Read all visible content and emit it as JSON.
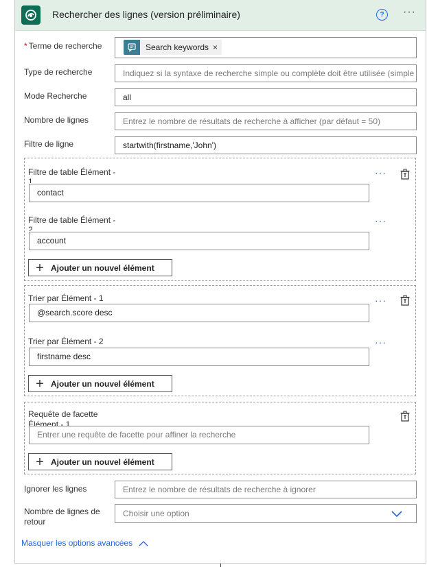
{
  "header": {
    "title": "Rechercher des lignes (version préliminaire)",
    "help": "?",
    "more": "···"
  },
  "fields": {
    "search_term_label": "Terme de recherche",
    "search_term_required": "*",
    "search_term_token": "Search keywords",
    "search_term_token_remove": "×",
    "search_type_label": "Type de recherche",
    "search_type_placeholder": "Indiquez si la syntaxe de recherche simple ou complète doit être utilisée (simple",
    "search_mode_label": "Mode Recherche",
    "search_mode_value": "all",
    "row_count_label": "Nombre de lignes",
    "row_count_placeholder": "Entrez le nombre de résultats de recherche à afficher (par défaut = 50)",
    "row_filter_label": "Filtre de ligne",
    "row_filter_value": "startwith(firstname,'John')",
    "skip_rows_label": "Ignorer les lignes",
    "skip_rows_placeholder": "Entrez le nombre de résultats de recherche à ignorer",
    "return_rows_label_line1": "Nombre de lignes de",
    "return_rows_label_line2": "retour",
    "return_rows_placeholder": "Choisir une option"
  },
  "table_filter": {
    "items": [
      {
        "label_line1": "Filtre de table Élément -",
        "label_line2": "1",
        "value": "contact"
      },
      {
        "label_line1": "Filtre de table Élément -",
        "label_line2": "2",
        "value": "account"
      }
    ],
    "add_label": "Ajouter un nouvel élément"
  },
  "order_by": {
    "items": [
      {
        "label": "Trier par Élément - 1",
        "value": "@search.score desc"
      },
      {
        "label": "Trier par Élément - 2",
        "value": "firstname desc"
      }
    ],
    "add_label": "Ajouter un nouvel élément"
  },
  "facet": {
    "label_line1": "Requête de facette",
    "label_line2": "Élément - 1",
    "placeholder": "Entrer une requête de facette pour affiner la recherche",
    "add_label": "Ajouter un nouvel élément"
  },
  "item_more": "···",
  "advanced_toggle": "Masquer les options avancées",
  "colors": {
    "header_bg": "#e1efe6",
    "logo_bg": "#0d6e55",
    "accent": "#2266e3",
    "token_icon_bg": "#3b7d93",
    "required": "#c50f1f"
  }
}
